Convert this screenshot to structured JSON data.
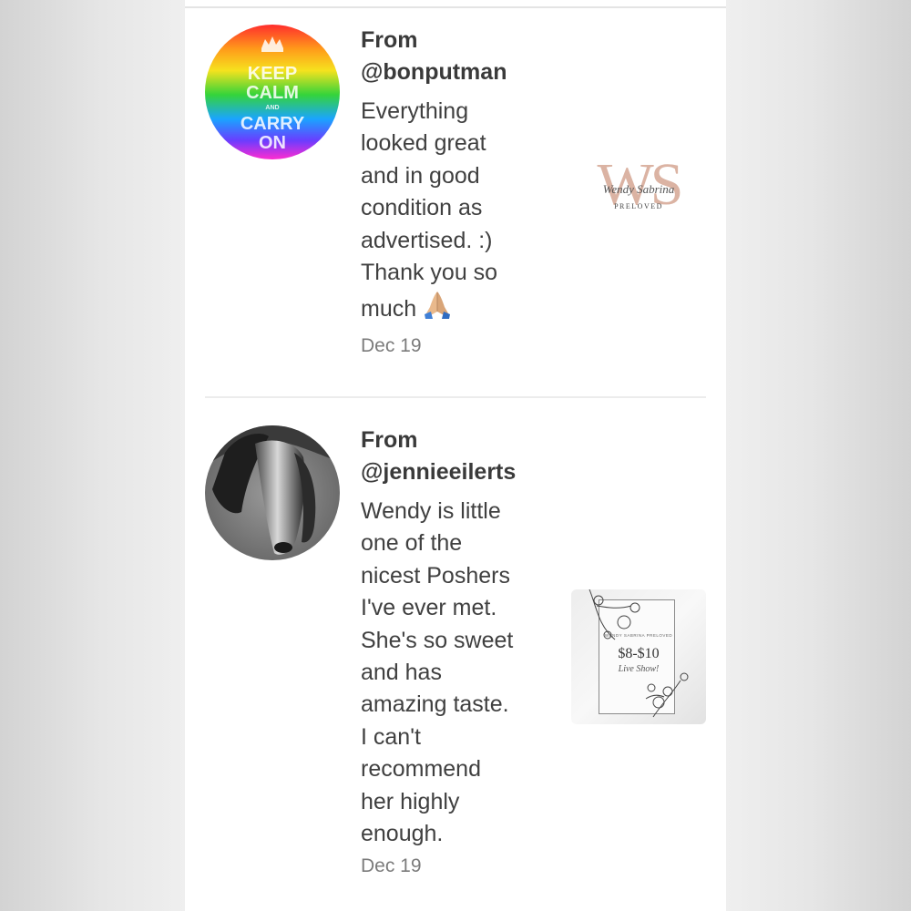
{
  "reviews": [
    {
      "from_label": "From",
      "username": "@bonputman",
      "avatar": {
        "type": "keep-calm-rainbow",
        "lines": [
          "KEEP",
          "CALM",
          "AND",
          "CARRY",
          "ON"
        ]
      },
      "comment": "Everything\nlooked great\nand in good\ncondition as\nadvertised. :)\nThank you so\nmuch",
      "comment_emoji": "folded-hands-icon",
      "date": "Dec 19",
      "listing_thumb": {
        "initials": "WS",
        "script": "Wendy Sabrina",
        "sub": "PRELOVED"
      }
    },
    {
      "from_label": "From",
      "username": "@jennieeilerts",
      "avatar": {
        "type": "horse-photo-grayscale"
      },
      "comment": "Wendy is little\none of the\nnicest Poshers\nI've ever met.\nShe's so sweet\nand has\namazing taste.\nI can't\nrecommend\nher highly\nenough.",
      "date": "Dec 19",
      "listing_thumb": {
        "small_text": "WENDY SABRINA PRELOVED",
        "price": "$8-$10",
        "script": "Live Show!"
      }
    }
  ],
  "colors": {
    "text": "#3a3a3a",
    "date": "#7b7b7b",
    "divider": "#ececec",
    "accent_rose": "#dbb3a3"
  }
}
